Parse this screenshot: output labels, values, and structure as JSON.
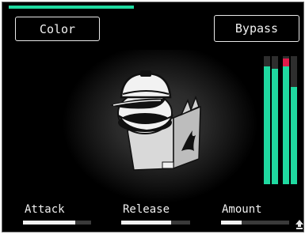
{
  "buttons": {
    "color_label": "Color",
    "bypass_label": "Bypass"
  },
  "top_progress": {
    "value": 0.42
  },
  "meters": [
    {
      "level": 0.92,
      "peak": false
    },
    {
      "level": 0.9,
      "peak": false
    },
    {
      "level": 0.93,
      "peak": true
    },
    {
      "level": 0.76,
      "peak": false
    }
  ],
  "controls": [
    {
      "label": "Attack",
      "value": 0.77
    },
    {
      "label": "Release",
      "value": 0.72
    },
    {
      "label": "Amount",
      "value": 0.3
    }
  ],
  "colors": {
    "accent": "#1fd9a0",
    "peak": "#e21a4a",
    "background": "#000000"
  },
  "icons": {
    "display": "cap-and-box-illustration",
    "corner": "arrow-up-icon"
  }
}
